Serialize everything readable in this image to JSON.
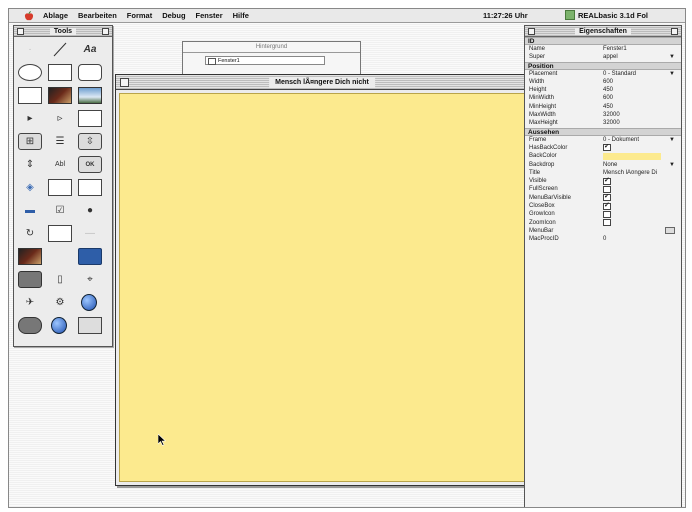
{
  "menubar": {
    "items": [
      "Ablage",
      "Bearbeiten",
      "Format",
      "Debug",
      "Fenster",
      "Hilfe"
    ],
    "clock": "11:27:26 Uhr",
    "app": "REALbasic 3.1d Fol"
  },
  "tools_palette": {
    "title": "Tools",
    "text_tool_label": "Aa"
  },
  "background_window": {
    "title": "Hintergrund",
    "row_label": "Fenster1"
  },
  "main_window": {
    "title": "Mensch lÃ¤ngere Dich nicht",
    "canvas_color": "#fcea8e"
  },
  "properties": {
    "title": "Eigenschaften",
    "sections": [
      {
        "name": "ID",
        "rows": [
          {
            "name": "Name",
            "value": "Fenster1"
          },
          {
            "name": "Super",
            "value": "appel",
            "dropdown": true
          }
        ]
      },
      {
        "name": "Position",
        "rows": [
          {
            "name": "Placement",
            "value": "0 - Standard",
            "dropdown": true
          },
          {
            "name": "Width",
            "value": "600"
          },
          {
            "name": "Height",
            "value": "450"
          },
          {
            "name": "MinWidth",
            "value": "600"
          },
          {
            "name": "MinHeight",
            "value": "450"
          },
          {
            "name": "MaxWidth",
            "value": "32000"
          },
          {
            "name": "MaxHeight",
            "value": "32000"
          }
        ]
      },
      {
        "name": "Aussehen",
        "rows": [
          {
            "name": "Frame",
            "value": "0 - Dokument",
            "dropdown": true
          },
          {
            "name": "HasBackColor",
            "check": true
          },
          {
            "name": "BackColor",
            "color": "#fcea8e"
          },
          {
            "name": "Backdrop",
            "value": "None",
            "dropdown": true
          },
          {
            "name": "Title",
            "value": "Mensch lÃ¤ngere Di"
          },
          {
            "name": "Visible",
            "check": true
          },
          {
            "name": "FullScreen",
            "check": false
          },
          {
            "name": "MenuBarVisible",
            "check": true
          },
          {
            "name": "CloseBox",
            "check": true
          },
          {
            "name": "GrowIcon",
            "check": false
          },
          {
            "name": "ZoomIcon",
            "check": false
          },
          {
            "name": "MenuBar",
            "more": true
          },
          {
            "name": "MacProcID",
            "value": "0"
          }
        ]
      }
    ]
  }
}
